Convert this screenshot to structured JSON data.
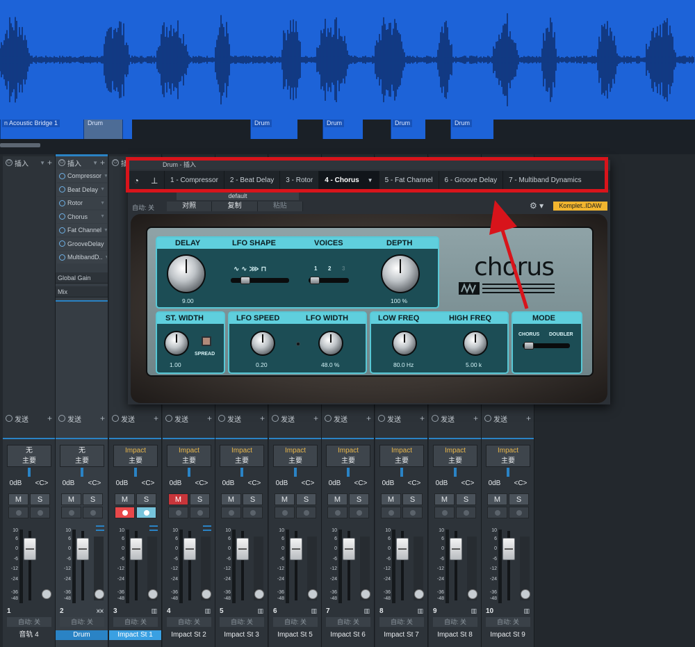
{
  "arrange": {
    "clips": [
      {
        "label": "n Acoustic Bridge 1"
      },
      {
        "label": "Drum"
      },
      {
        "label": "Drum"
      },
      {
        "label": "Drum"
      },
      {
        "label": "Drum"
      },
      {
        "label": "Drum"
      }
    ]
  },
  "mixer": {
    "insert_header": "插入",
    "send_header": "发送",
    "global_gain": "Global Gain",
    "mix": "Mix",
    "inserts": [
      "Compressor",
      "Beat Delay",
      "Rotor",
      "Chorus",
      "Fat Channel",
      "GrooveDelay",
      "MultibandD.."
    ],
    "strips": [
      {
        "num": "1",
        "input": "无",
        "output": "主要",
        "vol": "0dB",
        "pan": "<C>",
        "mute": "M",
        "solo": "S",
        "auto": "自动: 关",
        "name": "音轨 4",
        "icon": ""
      },
      {
        "num": "2",
        "input": "无",
        "output": "主要",
        "vol": "0dB",
        "pan": "<C>",
        "mute": "M",
        "solo": "S",
        "auto": "自动: 关",
        "name": "Drum",
        "icon": "⩙⩙"
      },
      {
        "num": "3",
        "input": "Impact",
        "output": "主要",
        "vol": "0dB",
        "pan": "<C>",
        "mute": "M",
        "solo": "S",
        "auto": "自动: 关",
        "name": "Impact St 1",
        "icon": "▥"
      },
      {
        "num": "4",
        "input": "Impact",
        "output": "主要",
        "vol": "0dB",
        "pan": "<C>",
        "mute": "M",
        "solo": "S",
        "auto": "自动: 关",
        "name": "Impact St 2",
        "icon": "▥"
      },
      {
        "num": "5",
        "input": "Impact",
        "output": "主要",
        "vol": "0dB",
        "pan": "<C>",
        "mute": "M",
        "solo": "S",
        "auto": "自动: 关",
        "name": "Impact St 3",
        "icon": "▥"
      },
      {
        "num": "6",
        "input": "Impact",
        "output": "主要",
        "vol": "0dB",
        "pan": "<C>",
        "mute": "M",
        "solo": "S",
        "auto": "自动: 关",
        "name": "Impact St 5",
        "icon": "▥"
      },
      {
        "num": "7",
        "input": "Impact",
        "output": "主要",
        "vol": "0dB",
        "pan": "<C>",
        "mute": "M",
        "solo": "S",
        "auto": "自动: 关",
        "name": "Impact St 6",
        "icon": "▥"
      },
      {
        "num": "8",
        "input": "Impact",
        "output": "主要",
        "vol": "0dB",
        "pan": "<C>",
        "mute": "M",
        "solo": "S",
        "auto": "自动: 关",
        "name": "Impact St 7",
        "icon": "▥"
      },
      {
        "num": "9",
        "input": "Impact",
        "output": "主要",
        "vol": "0dB",
        "pan": "<C>",
        "mute": "M",
        "solo": "S",
        "auto": "自动: 关",
        "name": "Impact St 8",
        "icon": "▥"
      },
      {
        "num": "10",
        "input": "Impact",
        "output": "主要",
        "vol": "0dB",
        "pan": "<C>",
        "mute": "M",
        "solo": "S",
        "auto": "自动: 关",
        "name": "Impact St 9",
        "icon": "▥"
      }
    ],
    "scale": [
      "10",
      "6",
      "0",
      "-6",
      "-12",
      "-24",
      "-36",
      "-48"
    ]
  },
  "plugin": {
    "title": "Drum - 插入",
    "tabs": [
      "1 - Compressor",
      "2 - Beat Delay",
      "3 - Rotor",
      "4 - Chorus",
      "5 - Fat Channel",
      "6 - Groove Delay",
      "7 - Multiband Dynamics"
    ],
    "active_tab": "4 - Chorus",
    "preset": "default",
    "auto": "自动: 关",
    "pair": "对照",
    "copy": "复制",
    "paste": "粘贴",
    "kontakt": "Komplet..IDAW",
    "chorus": {
      "logo": "chorus",
      "delay_label": "DELAY",
      "delay_value": "9.00",
      "lfo_shape_label": "LFO SHAPE",
      "voices_label": "VOICES",
      "voices": [
        "1",
        "2",
        "3"
      ],
      "depth_label": "DEPTH",
      "depth_value": "100 %",
      "st_width_label": "ST. WIDTH",
      "st_width_value": "1.00",
      "spread_label": "SPREAD",
      "lfo_speed_label": "LFO SPEED",
      "lfo_speed_value": "0.20",
      "lfo_width_label": "LFO WIDTH",
      "lfo_width_value": "48.0 %",
      "low_freq_label": "LOW FREQ",
      "low_freq_value": "80.0 Hz",
      "high_freq_label": "HIGH FREQ",
      "high_freq_value": "5.00 k",
      "mode_label": "MODE",
      "mode_chorus": "CHORUS",
      "mode_doubler": "DOUBLER"
    }
  },
  "colors": {
    "accent": "#2a83c5",
    "waveform": "#1d63d8",
    "highlight": "#d8141b",
    "panel": "#58c8d6"
  }
}
